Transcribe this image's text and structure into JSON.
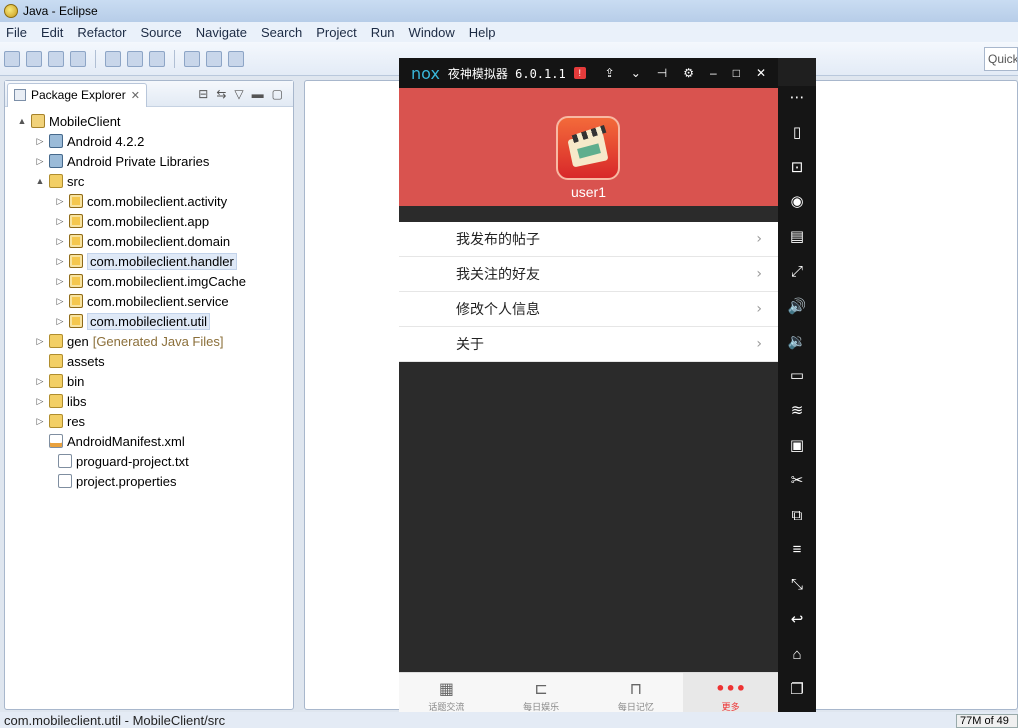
{
  "window": {
    "title": "Java - Eclipse"
  },
  "menubar": [
    "File",
    "Edit",
    "Refactor",
    "Source",
    "Navigate",
    "Search",
    "Project",
    "Run",
    "Window",
    "Help"
  ],
  "toolbar": {
    "quick_access": "Quick"
  },
  "package_explorer": {
    "tab_label": "Package Explorer",
    "tree": [
      {
        "label": "MobileClient",
        "icon": "project-icon",
        "twisty": "▲"
      },
      {
        "label": "Android 4.2.2",
        "icon": "library-icon",
        "twisty": "▷"
      },
      {
        "label": "Android Private Libraries",
        "icon": "library-icon",
        "twisty": "▷"
      },
      {
        "label": "src",
        "icon": "folder-icon",
        "twisty": "▲"
      },
      {
        "label": "com.mobileclient.activity",
        "icon": "package-icon",
        "twisty": "▷"
      },
      {
        "label": "com.mobileclient.app",
        "icon": "package-icon",
        "twisty": "▷"
      },
      {
        "label": "com.mobileclient.domain",
        "icon": "package-icon",
        "twisty": "▷"
      },
      {
        "label": "com.mobileclient.handler",
        "icon": "package-icon",
        "twisty": "▷"
      },
      {
        "label": "com.mobileclient.imgCache",
        "icon": "package-icon",
        "twisty": "▷"
      },
      {
        "label": "com.mobileclient.service",
        "icon": "package-icon",
        "twisty": "▷"
      },
      {
        "label": "com.mobileclient.util",
        "icon": "package-icon",
        "twisty": "▷"
      },
      {
        "label": "gen",
        "icon": "folder-icon",
        "twisty": "▷",
        "suffix": "[Generated Java Files]"
      },
      {
        "label": "assets",
        "icon": "folder-icon",
        "twisty": ""
      },
      {
        "label": "bin",
        "icon": "folder-icon",
        "twisty": "▷"
      },
      {
        "label": "libs",
        "icon": "folder-icon",
        "twisty": "▷"
      },
      {
        "label": "res",
        "icon": "folder-icon",
        "twisty": "▷"
      },
      {
        "label": "AndroidManifest.xml",
        "icon": "xml-file-icon",
        "twisty": ""
      },
      {
        "label": "proguard-project.txt",
        "icon": "text-file-icon",
        "twisty": ""
      },
      {
        "label": "project.properties",
        "icon": "text-file-icon",
        "twisty": ""
      }
    ]
  },
  "statusbar": {
    "text": "com.mobileclient.util - MobileClient/src",
    "heap": "77M of 49"
  },
  "nox": {
    "logo": "nox",
    "title": "夜神模拟器 6.0.1.1",
    "badge": "!",
    "side_icons": [
      "more-icon",
      "rotate-icon",
      "robot-icon",
      "location-icon",
      "keyboard-icon",
      "fullscreen-icon",
      "volume-up-icon",
      "volume-down-icon",
      "multi-instance-icon",
      "shake-icon",
      "apk-install-icon",
      "screenshot-icon",
      "copy-icon",
      "menu-icon",
      "expand-icon",
      "back-icon",
      "home-icon",
      "recent-icon",
      "expand-toolbar-icon"
    ]
  },
  "phone": {
    "username": "user1",
    "menu": [
      {
        "label": "我发布的帖子"
      },
      {
        "label": "我关注的好友"
      },
      {
        "label": "修改个人信息"
      },
      {
        "label": "关于"
      }
    ],
    "bottom_nav": [
      {
        "label": "话题交流",
        "icon": "film-icon"
      },
      {
        "label": "每日娱乐",
        "icon": "tray-icon"
      },
      {
        "label": "每日记忆",
        "icon": "book-icon"
      },
      {
        "label": "更多",
        "icon": "more-dots-icon"
      }
    ],
    "accent_color": "#d9534f",
    "active_nav_color": "#ee3333"
  }
}
